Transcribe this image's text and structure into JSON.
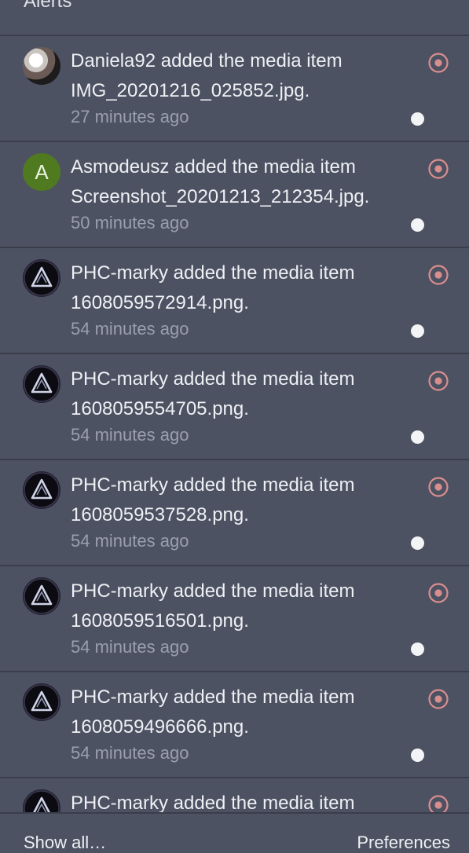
{
  "header": {
    "title": "Alerts"
  },
  "alerts": [
    {
      "line1": "Daniela92 added the media item",
      "line2": "IMG_20201216_025852.jpg.",
      "time": "27 minutes ago",
      "avatar": "photo"
    },
    {
      "line1": "Asmodeusz added the media item",
      "line2": "Screenshot_20201213_212354.jpg.",
      "time": "50 minutes ago",
      "avatar": "letter",
      "avatar_letter": "A"
    },
    {
      "line1": "PHC-marky added the media item",
      "line2": "1608059572914.png.",
      "time": "54 minutes ago",
      "avatar": "logo"
    },
    {
      "line1": "PHC-marky added the media item",
      "line2": "1608059554705.png.",
      "time": "54 minutes ago",
      "avatar": "logo"
    },
    {
      "line1": "PHC-marky added the media item",
      "line2": "1608059537528.png.",
      "time": "54 minutes ago",
      "avatar": "logo"
    },
    {
      "line1": "PHC-marky added the media item",
      "line2": "1608059516501.png.",
      "time": "54 minutes ago",
      "avatar": "logo"
    },
    {
      "line1": "PHC-marky added the media item",
      "line2": "1608059496666.png.",
      "time": "54 minutes ago",
      "avatar": "logo"
    },
    {
      "line1": "PHC-marky added the media item",
      "line2": "",
      "time": "",
      "avatar": "logo"
    }
  ],
  "footer": {
    "show_all": "Show all…",
    "preferences": "Preferences"
  },
  "colors": {
    "background": "#4d5262",
    "divider": "#3a3e4b",
    "mark_read_icon": "#d98e8e",
    "unread_dot": "#f3f4f6",
    "letter_avatar": "#4f7a1f"
  }
}
